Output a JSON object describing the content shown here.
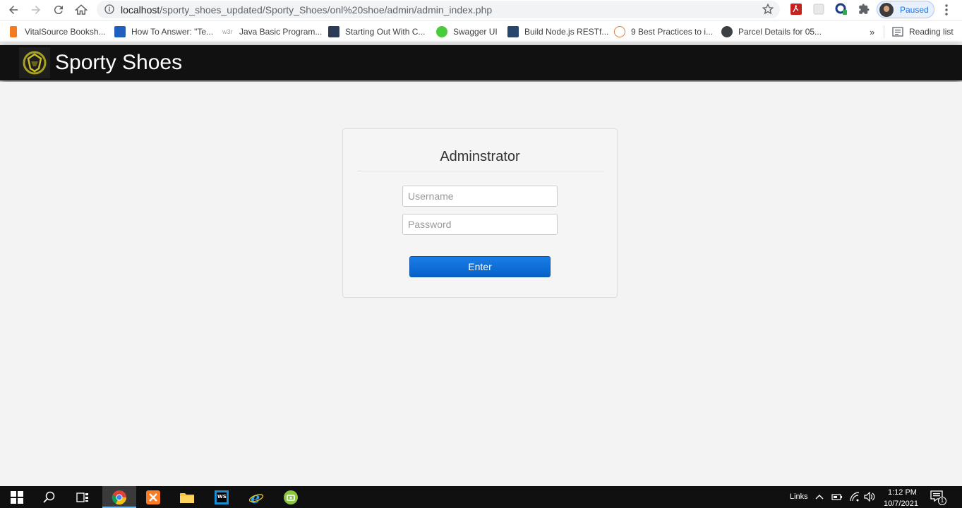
{
  "browser": {
    "url_host": "localhost",
    "url_path": "/sporty_shoes_updated/Sporty_Shoes/onl%20shoe/admin/admin_index.php",
    "profile_status": "Paused"
  },
  "bookmarks": [
    {
      "label": "VitalSource Booksh...",
      "icon": "vitalsource-icon",
      "color": "#f47b20"
    },
    {
      "label": "How To Answer: \"Te...",
      "icon": "snowflake-icon",
      "color": "#1f5fbf"
    },
    {
      "label": "Java Basic Program...",
      "icon": "w3r-icon",
      "color": "#9aa0a6"
    },
    {
      "label": "Starting Out With C...",
      "icon": "book-cover-icon",
      "color": "#2b3a55"
    },
    {
      "label": "Swagger UI",
      "icon": "swagger-icon",
      "color": "#49cc39"
    },
    {
      "label": "Build Node.js RESTf...",
      "icon": "node-article-icon",
      "color": "#24476b"
    },
    {
      "label": "9 Best Practices to i...",
      "icon": "hexagon-icon",
      "color": "#e07b39"
    },
    {
      "label": "Parcel Details for 05...",
      "icon": "parcel-icon",
      "color": "#3c4043"
    }
  ],
  "bookmarks_more": "»",
  "reading_list": "Reading list",
  "site": {
    "title": "Sporty Shoes"
  },
  "login": {
    "title": "Adminstrator",
    "username_placeholder": "Username",
    "password_placeholder": "Password",
    "enter_label": "Enter"
  },
  "taskbar": {
    "links_label": "Links",
    "time": "1:12 PM",
    "date": "10/7/2021",
    "notification_count": "1"
  },
  "colors": {
    "header_bg": "#111111",
    "page_bg": "#f3f3f3",
    "button_blue": "#0a6cd6"
  }
}
